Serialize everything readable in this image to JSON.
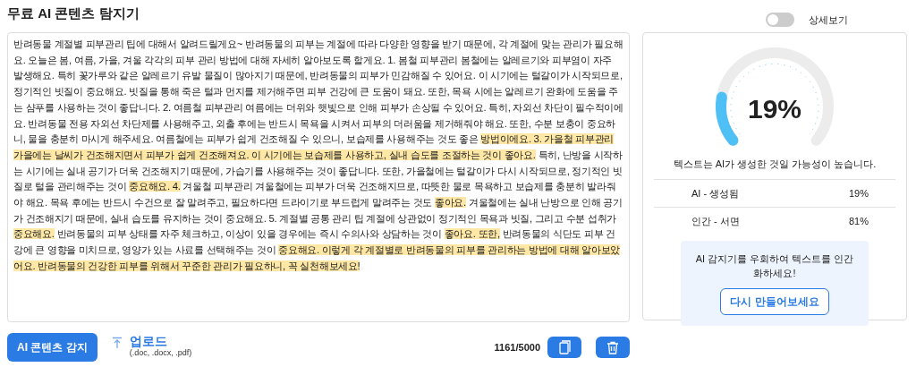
{
  "title": "무료 AI 콘텐츠 탐지기",
  "detail_toggle": {
    "label": "상세보기",
    "on": false
  },
  "essay": {
    "segments": [
      {
        "text": "반려동물 계절별 피부관리 팁에 대해서 알려드릴게요~ 반려동물의 피부는 계절에 따라 다양한 영향을 받기 때문에, 각 계절에 맞는 관리가 필요해요. 오늘은 봄, 여름, 가을, 겨울 각각의 피부 관리 방법에 대해 자세히 알아보도록 할게요. 1. 봄철 피부관리 봄철에는 알레르기와 피부염이 자주 발생해요. 특히 꽃가루와 같은 알레르기 유발 물질이 많아지기 때문에, 반려동물의 피부가 민감해질 수 있어요. 이 시기에는 털갈이가 시작되므로, 정기적인 빗질이 중요해요. 빗질을 통해 죽은 털과 먼지를 제거해주면 피부 건강에 큰 도움이 돼요. 또한, 목욕 시에는 알레르기 완화에 도움을 주는 샴푸를 사용하는 것이 좋답니다. 2. 여름철 피부관리 여름에는 더위와 햇빛으로 인해 피부가 손상될 수 있어요. 특히, 자외선 차단이 필수적이에요. 반려동물 전용 자외선 차단제를 사용해주고, 외출 후에는 반드시 목욕을 시켜서 피부의 더러움을 제거해줘야 해요. 또한, 수분 보충이 중요하니, 물을 충분히 마시게 해주세요. 여름철에는 피부가 쉽게 건조해질 수 있으니, 보습제를 사용해주는 것도 좋은 ",
        "highlighted": false
      },
      {
        "text": "방법이에요. 3. 가을철 피부관리 가을에는 날씨가 건조해지면서 피부가 쉽게 건조해져요. 이 시기에는 보습제를 사용하고, 실내 습도를 조절하는 것이 좋아요.",
        "highlighted": true
      },
      {
        "text": " 특히, 난방을 시작하는 시기에는 실내 공기가 더욱 건조해지기 때문에, 가습기를 사용해주는 것이 좋답니다. 또한, 가을철에는 털갈이가 다시 시작되므로, 정기적인 빗질로 털을 관리해주는 것이 ",
        "highlighted": false
      },
      {
        "text": "중요해요. 4.",
        "highlighted": true
      },
      {
        "text": " 겨울철 피부관리 겨울철에는 피부가 더욱 건조해지므로, 따뜻한 물로 목욕하고 보습제를 충분히 발라줘야 해요. 목욕 후에는 반드시 수건으로 잘 말려주고, 필요하다면 드라이기로 부드럽게 말려주는 것도 ",
        "highlighted": false
      },
      {
        "text": "좋아요.",
        "highlighted": true
      },
      {
        "text": " 겨울철에는 실내 난방으로 인해 공기가 건조해지기 때문에, 실내 습도를 유지하는 것이 중요해요. 5. 계절별 공통 관리 팁 계절에 상관없이 정기적인 목욕과 빗질, 그리고 수분 섭취가 ",
        "highlighted": false
      },
      {
        "text": "중요해요.",
        "highlighted": true
      },
      {
        "text": " 반려동물의 피부 상태를 자주 체크하고, 이상이 있을 경우에는 즉시 수의사와 상담하는 것이 ",
        "highlighted": false
      },
      {
        "text": "좋아요. 또한,",
        "highlighted": true
      },
      {
        "text": " 반려동물의 식단도 피부 건강에 큰 영향을 미치므로, 영양가 있는 사료를 선택해주는 것이 ",
        "highlighted": false
      },
      {
        "text": "중요해요. 이렇게 각 계절별로 반려동물의 피부를 관리하는 방법에 대해 알아보았어요. 반려동물의 건강한 피부를 위해서 꾸준한 관리가 필요하니, 꼭 실천해보세요!",
        "highlighted": true
      }
    ]
  },
  "result": {
    "gauge": {
      "reading": "19%"
    },
    "verdict": "텍스트는 AI가 생성한 것일 가능성이 높습니다.",
    "rows": [
      {
        "label": "AI - 생성됨",
        "value": "19%"
      },
      {
        "label": "인간 - 서면",
        "value": "81%"
      }
    ],
    "promo": {
      "text": "AI 감지기를 우회하여 텍스트를 인간화하세요!",
      "button": "다시 만들어보세요"
    }
  },
  "footer": {
    "detect_button": "AI 콘텐츠 감지",
    "upload": {
      "label": "업로드",
      "formats": "(.doc, .docx, .pdf)"
    },
    "count": "1161/5000"
  }
}
